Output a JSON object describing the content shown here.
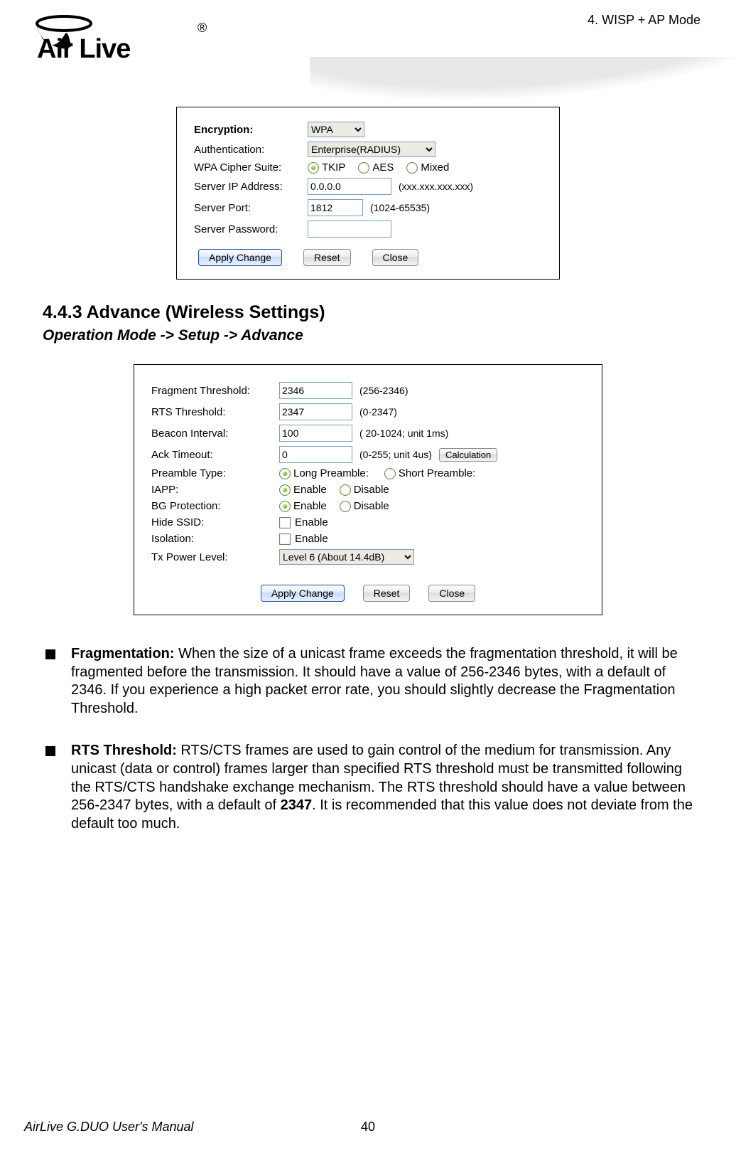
{
  "header": {
    "mode": "4.  WISP  +  AP  Mode"
  },
  "logo_text": "Air Live",
  "panel1": {
    "encryption_label": "Encryption:",
    "encryption_value": "WPA",
    "auth_label": "Authentication:",
    "auth_value": "Enterprise(RADIUS)",
    "cipher_label": "WPA Cipher Suite:",
    "cipher_tkip": "TKIP",
    "cipher_aes": "AES",
    "cipher_mixed": "Mixed",
    "ip_label": "Server IP Address:",
    "ip_value": "0.0.0.0",
    "ip_hint": "(xxx.xxx.xxx.xxx)",
    "port_label": "Server Port:",
    "port_value": "1812",
    "port_hint": "(1024-65535)",
    "pass_label": "Server Password:",
    "pass_value": "",
    "btn_apply": "Apply Change",
    "btn_reset": "Reset",
    "btn_close": "Close"
  },
  "section": {
    "title": "4.4.3 Advance (Wireless Settings)",
    "breadcrumb": "Operation Mode -> Setup -> Advance"
  },
  "panel2": {
    "frag_label": "Fragment Threshold:",
    "frag_value": "2346",
    "frag_hint": "(256-2346)",
    "rts_label": "RTS Threshold:",
    "rts_value": "2347",
    "rts_hint": "(0-2347)",
    "beacon_label": "Beacon Interval:",
    "beacon_value": "100",
    "beacon_hint": "( 20-1024; unit 1ms)",
    "ack_label": "Ack Timeout:",
    "ack_value": "0",
    "ack_hint": "(0-255; unit 4us)",
    "ack_calc": "Calculation",
    "preamble_label": "Preamble Type:",
    "preamble_long": "Long Preamble:",
    "preamble_short": "Short Preamble:",
    "iapp_label": "IAPP:",
    "bg_label": "BG Protection:",
    "enable": "Enable",
    "disable": "Disable",
    "hide_label": "Hide SSID:",
    "iso_label": "Isolation:",
    "tx_label": "Tx Power Level:",
    "tx_value": "Level 6 (About 14.4dB)",
    "btn_apply": "Apply Change",
    "btn_reset": "Reset",
    "btn_close": "Close"
  },
  "body": {
    "frag_title": "Fragmentation:",
    "frag_text": " When the size of a unicast frame exceeds the fragmentation threshold, it will be fragmented before the transmission. It should have a value of 256-2346 bytes, with a default of 2346.    If you experience a high packet error rate, you should slightly decrease the Fragmentation Threshold.",
    "rts_title": "RTS Threshold:",
    "rts_text_a": " RTS/CTS frames are used to gain control of the medium for transmission. Any unicast (data or control) frames larger than specified RTS threshold must be transmitted following the RTS/CTS handshake exchange mechanism. The RTS threshold should have a value between 256-2347 bytes, with a default of ",
    "rts_bold": "2347",
    "rts_text_b": ". It is recommended that this value does not deviate from the default too much."
  },
  "footer": {
    "left": "AirLive G.DUO User's Manual",
    "page": "40"
  }
}
